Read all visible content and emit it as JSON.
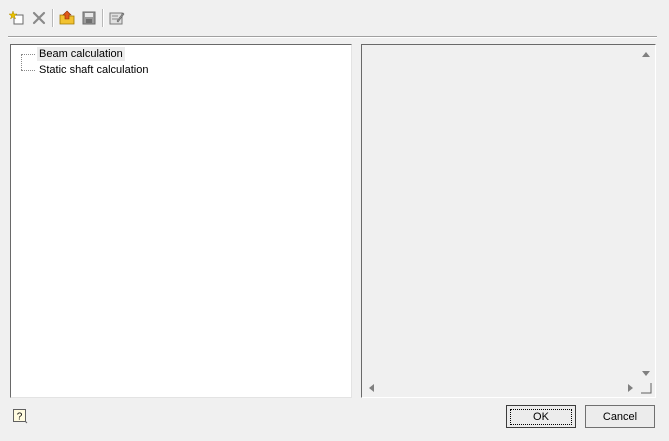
{
  "toolbar": {
    "icons": [
      "new-item-icon",
      "delete-icon",
      "open-folder-icon",
      "save-icon",
      "properties-icon"
    ]
  },
  "tree": {
    "items": [
      {
        "label": "Beam calculation",
        "selected": true
      },
      {
        "label": "Static shaft calculation",
        "selected": false
      }
    ]
  },
  "buttons": {
    "ok_label": "OK",
    "cancel_label": "Cancel",
    "help_glyph": "?"
  },
  "colors": {
    "window_bg": "#f0f0f0",
    "tree_bg": "#ffffff",
    "new_icon_star": "#e8c200",
    "delete_icon": "#8a8a8a",
    "folder_icon": "#e6b400"
  }
}
